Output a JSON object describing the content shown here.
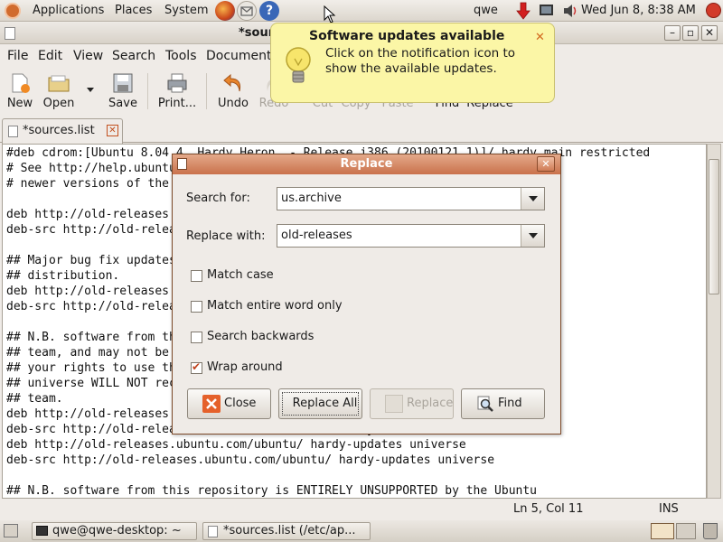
{
  "top_panel": {
    "applications": "Applications",
    "places": "Places",
    "system": "System",
    "user": "qwe",
    "clock": "Wed Jun  8,  8:38 AM"
  },
  "window": {
    "title": "*sources.list (/etc/apt) - gedit"
  },
  "menu": [
    "File",
    "Edit",
    "View",
    "Search",
    "Tools",
    "Documents"
  ],
  "toolbar": {
    "new": "New",
    "open": "Open",
    "save": "Save",
    "print": "Print...",
    "undo": "Undo",
    "redo": "Redo",
    "cut": "Cut",
    "copy": "Copy",
    "paste": "Paste",
    "find": "Find",
    "replace": "Replace"
  },
  "tab": {
    "label": "*sources.list"
  },
  "code_lines": [
    "#deb cdrom:[Ubuntu 8.04.4 _Hardy Heron_ - Release i386 (20100121.1)]/ hardy main restricted",
    "# See http://help.ubuntu.com/community/UpgradeNotes for how to upgrade to",
    "# newer versions of the distribution.",
    "",
    "deb http://old-releases.ubuntu.com/ubuntu/ hardy main restricted",
    "deb-src http://old-releases.ubuntu.com/ubuntu/ hardy main restricted",
    "",
    "## Major bug fix updates produced after the final release of the",
    "## distribution.",
    "deb http://old-releases.ubuntu.com/ubuntu/ hardy-updates main restricted",
    "deb-src http://old-releases.ubuntu.com/ubuntu/ hardy-updates main restricted",
    "",
    "## N.B. software from this repository is ENTIRELY UNSUPPORTED by the Ubuntu",
    "## team, and may not be under a free licence. Please satisfy yourself as to",
    "## your rights to use the software. Also, please note that software in",
    "## universe WILL NOT receive any review or updates from the Ubuntu security",
    "## team.",
    "deb http://old-releases.ubuntu.com/ubuntu/ hardy universe",
    "deb-src http://old-releases.ubuntu.com/ubuntu/ hardy universe",
    "deb http://old-releases.ubuntu.com/ubuntu/ hardy-updates universe",
    "deb-src http://old-releases.ubuntu.com/ubuntu/ hardy-updates universe",
    "",
    "## N.B. software from this repository is ENTIRELY UNSUPPORTED by the Ubuntu"
  ],
  "status": {
    "position": "Ln 5, Col 11",
    "mode": "INS"
  },
  "notification": {
    "title": "Software updates available",
    "message": "Click on the notification icon to show the available updates."
  },
  "dialog": {
    "title": "Replace",
    "search_label": "Search for:",
    "search_value": "us.archive",
    "replace_label": "Replace with:",
    "replace_value": "old-releases",
    "options": [
      {
        "label": "Match case",
        "checked": false
      },
      {
        "label": "Match entire word only",
        "checked": false
      },
      {
        "label": "Search backwards",
        "checked": false
      },
      {
        "label": "Wrap around",
        "checked": true
      }
    ],
    "close_btn": "Close",
    "replace_all_btn": "Replace All",
    "replace_btn": "Replace",
    "find_btn": "Find"
  },
  "taskbar": {
    "terminal": "qwe@qwe-desktop: ~",
    "gedit": "*sources.list (/etc/ap..."
  },
  "colors": {
    "dialog_title": "#c9714b",
    "notification_bg": "#fbf6a6",
    "accent_orange": "#e55b15"
  }
}
